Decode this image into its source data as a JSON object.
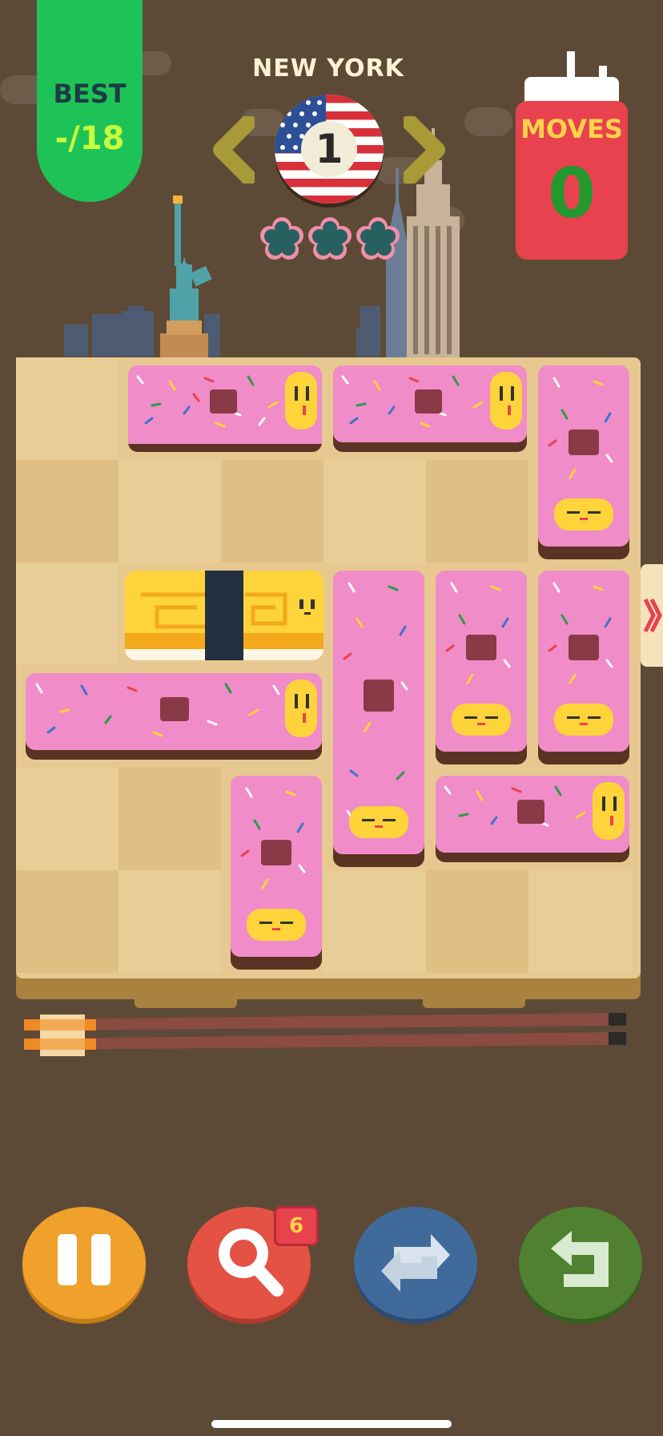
{
  "hud": {
    "best_label": "BEST",
    "best_value": "-/18",
    "city": "NEW YORK",
    "level": "1",
    "moves_label": "MOVES",
    "moves_value": "0",
    "stars_earned": 0,
    "stars_total": 3
  },
  "board": {
    "columns": 6,
    "rows": 6,
    "exit_row": 3
  },
  "controls": {
    "pause_icon": "pause-icon",
    "hint_icon": "magnifier-icon",
    "hint_count": "6",
    "restart_icon": "restart-arrows-icon",
    "undo_icon": "undo-arrow-icon"
  },
  "colors": {
    "background": "#5d4a36",
    "best_tab": "#1ec357",
    "moves_panel": "#e8424e",
    "pause_button": "#f0a12b",
    "hint_button": "#e35242",
    "restart_button": "#3f6a9a",
    "undo_button": "#4f8131",
    "board": "#e7c890",
    "donut_frosting": "#f08cc8",
    "sushi": "#ffd33a"
  }
}
